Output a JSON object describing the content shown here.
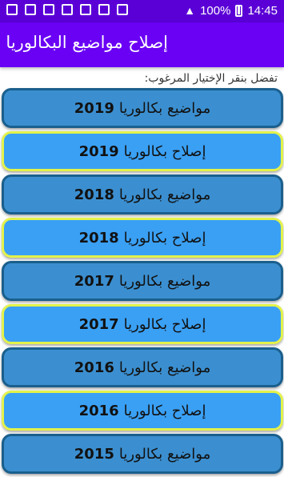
{
  "status_bar": {
    "battery": "100%",
    "time": "14:45",
    "left_icons": [
      "image-icon",
      "gallery-icon",
      "calendar-icon",
      "calendar-icon",
      "mute-icon",
      "alarm-icon",
      "wifi-icon"
    ],
    "signal_glyph": "▲",
    "wifi_glyph": "◔"
  },
  "app_bar": {
    "title": "إصلاح مواضيع البكالوريا"
  },
  "hint": "تفضل بنقر الإختيار المرغوب:",
  "items": [
    {
      "text": "مواضيع بكالوريا",
      "year": "2019",
      "kind": "topic"
    },
    {
      "text": "إصلاح بكالوريا",
      "year": "2019",
      "kind": "fix"
    },
    {
      "text": "مواضيع بكالوريا",
      "year": "2018",
      "kind": "topic"
    },
    {
      "text": "إصلاح بكالوريا",
      "year": "2018",
      "kind": "fix"
    },
    {
      "text": "مواضيع بكالوريا",
      "year": "2017",
      "kind": "topic"
    },
    {
      "text": "إصلاح بكالوريا",
      "year": "2017",
      "kind": "fix"
    },
    {
      "text": "مواضيع بكالوريا",
      "year": "2016",
      "kind": "topic"
    },
    {
      "text": "إصلاح بكالوريا",
      "year": "2016",
      "kind": "fix"
    },
    {
      "text": "مواضيع بكالوريا",
      "year": "2015",
      "kind": "topic"
    }
  ],
  "colors": {
    "status_bar": "#5a00d6",
    "app_bar": "#6a00f4",
    "topic_button": "#3b8fd0",
    "fix_button": "#3aa0f4",
    "fix_border": "#e3f24a"
  }
}
